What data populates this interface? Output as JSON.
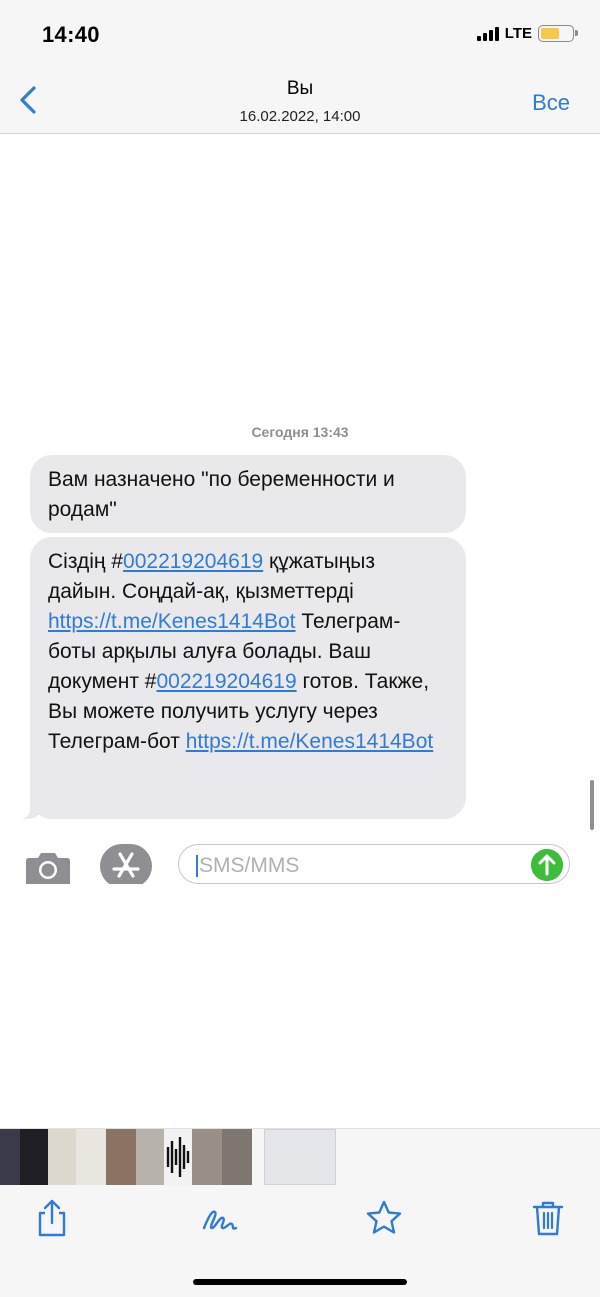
{
  "status_bar": {
    "time": "14:40",
    "network": "LTE",
    "battery_level": 0.6,
    "battery_color": "#f7c948"
  },
  "header": {
    "back_icon": "chevron-left-icon",
    "title": "Вы",
    "subtitle": "16.02.2022, 14:00",
    "all_label": "Все"
  },
  "conversation": {
    "timestamp": "Сегодня 13:43",
    "messages": [
      {
        "text": "Вам назначено \"по беременности и родам\""
      },
      {
        "parts": [
          {
            "t": "Сіздің  #"
          },
          {
            "t": "002219204619",
            "link": true
          },
          {
            "t": " құжатыңыз дайын. Соңдай-ақ, қызметтерді "
          },
          {
            "t": "https://t.me/Kenes1414Bot",
            "link": true
          },
          {
            "t": " Телеграм-боты арқылы алуға болады. Ваш документ #"
          },
          {
            "t": "002219204619",
            "link": true
          },
          {
            "t": " готов. Также, Вы можете получить услугу через Телеграм-бот "
          },
          {
            "t": "https://t.me/Kenes1414Bot",
            "link": true
          }
        ]
      }
    ]
  },
  "composer": {
    "camera_icon": "camera-icon",
    "apps_icon": "app-store-icon",
    "placeholder": "SMS/MMS",
    "value": "",
    "send_icon": "arrow-up-icon"
  },
  "toolbar": {
    "share_icon": "share-icon",
    "markup_icon": "markup-pen-icon",
    "favorite_icon": "star-icon",
    "delete_icon": "trash-icon"
  },
  "colors": {
    "accent": "#2f7bd6",
    "bubble": "#e9e9eb",
    "send": "#3cbd3c"
  }
}
